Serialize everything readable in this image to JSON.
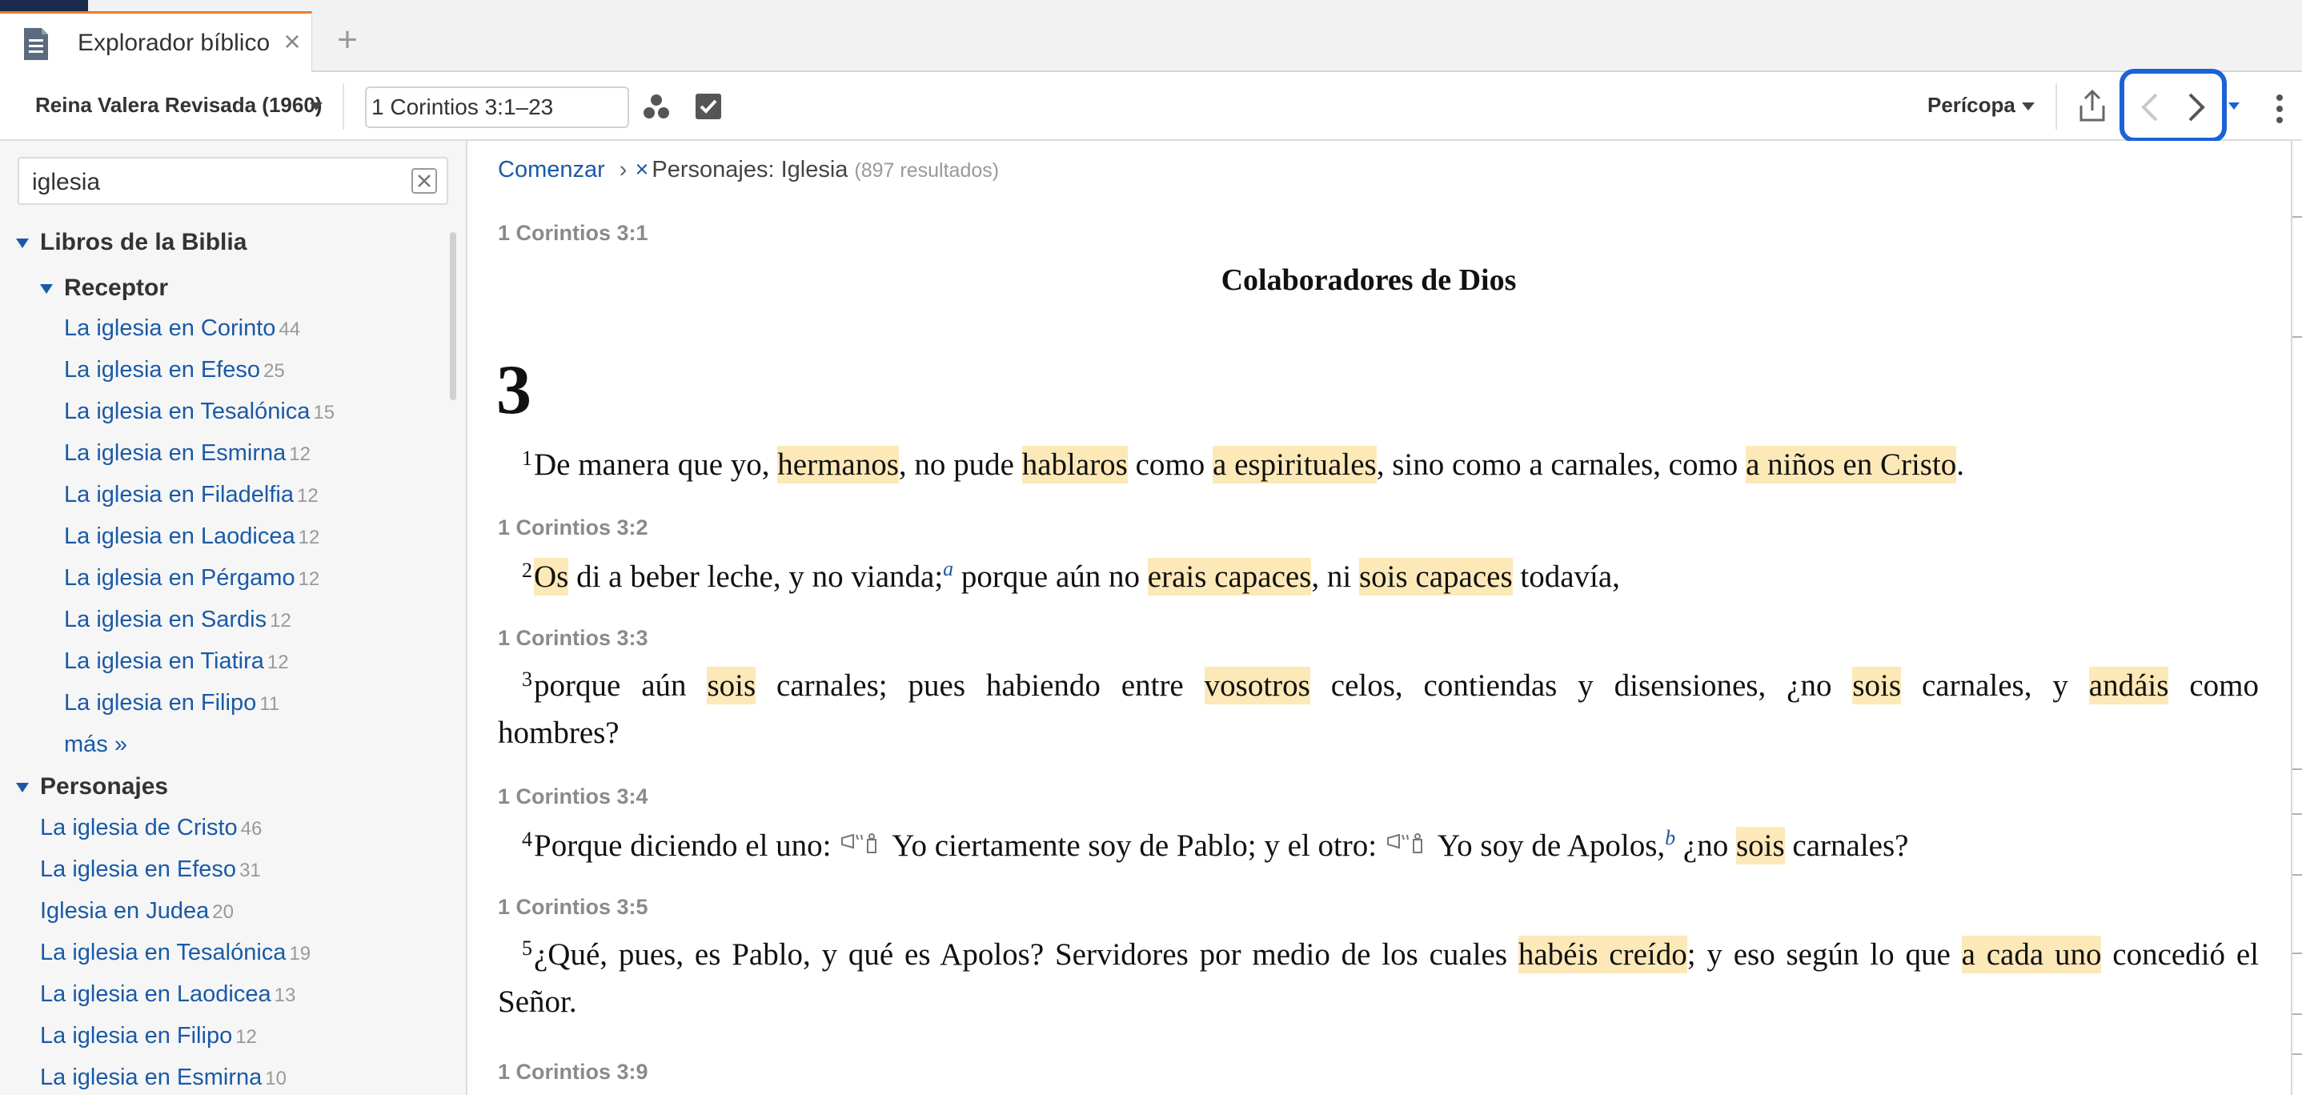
{
  "tab": {
    "title": "Explorador bíblico",
    "close_label": "×",
    "add_label": "+"
  },
  "toolbar": {
    "version": "Reina Valera Revisada (1960)",
    "reference": "1 Corintios 3:1–23",
    "view_mode": "Perícopa"
  },
  "sidebar": {
    "search_value": "iglesia",
    "sections": {
      "libros": {
        "header": "Libros de la Biblia",
        "receptor": {
          "header": "Receptor",
          "items": [
            {
              "label": "La iglesia en Corinto",
              "count": "44"
            },
            {
              "label": "La iglesia en Efeso",
              "count": "25"
            },
            {
              "label": "La iglesia en Tesalónica",
              "count": "15"
            },
            {
              "label": "La iglesia en Esmirna",
              "count": "12"
            },
            {
              "label": "La iglesia en Filadelfia",
              "count": "12"
            },
            {
              "label": "La iglesia en Laodicea",
              "count": "12"
            },
            {
              "label": "La iglesia en Pérgamo",
              "count": "12"
            },
            {
              "label": "La iglesia en Sardis",
              "count": "12"
            },
            {
              "label": "La iglesia en Tiatira",
              "count": "12"
            },
            {
              "label": "La iglesia en Filipo",
              "count": "11"
            }
          ],
          "more_label": "más »"
        }
      },
      "personajes": {
        "header": "Personajes",
        "items": [
          {
            "label": "La iglesia de Cristo",
            "count": "46"
          },
          {
            "label": "La iglesia en Efeso",
            "count": "31"
          },
          {
            "label": "Iglesia en Judea",
            "count": "20"
          },
          {
            "label": "La iglesia en Tesalónica",
            "count": "19"
          },
          {
            "label": "La iglesia en Laodicea",
            "count": "13"
          },
          {
            "label": "La iglesia en Filipo",
            "count": "12"
          },
          {
            "label": "La iglesia en Esmirna",
            "count": "10"
          }
        ]
      }
    }
  },
  "main": {
    "breadcrumb": {
      "start": "Comenzar",
      "separator": "›",
      "remove": "×",
      "current": "Personajes: Iglesia",
      "count": "(897 resultados)"
    },
    "pericope_title": "Colaboradores de Dios",
    "chapter": "3",
    "refs": [
      "1 Corintios 3:1",
      "1 Corintios 3:2",
      "1 Corintios 3:3",
      "1 Corintios 3:4",
      "1 Corintios 3:5",
      "1 Corintios 3:9"
    ],
    "verses": {
      "v1": {
        "num": "1",
        "parts": [
          "De manera que yo, ",
          "hermanos",
          ", no pude ",
          "hablaros",
          " como ",
          "a espirituales",
          ", sino como a carnales, como ",
          "a niños en Cristo",
          "."
        ]
      },
      "v2": {
        "num": "2",
        "parts": [
          "Os",
          " di a beber leche, y no vianda;",
          "a",
          " porque aún no ",
          "erais capaces",
          ", ni ",
          "sois capaces",
          " todavía,"
        ]
      },
      "v3": {
        "num": "3",
        "parts": [
          "porque aún ",
          "sois",
          " carnales; pues habiendo entre ",
          "vosotros",
          " celos, contiendas y disensiones, ¿no ",
          "sois",
          " carnales, y ",
          "andáis",
          " como"
        ],
        "line2": "hombres?"
      },
      "v4": {
        "num": "4",
        "parts": [
          "Porque diciendo el uno: ",
          "Yo ciertamente soy de Pablo; y el otro: ",
          "Yo soy de Apolos,",
          "b",
          " ¿no ",
          "sois",
          " carnales?"
        ]
      },
      "v5": {
        "num": "5",
        "parts": [
          "¿Qué, pues, es Pablo, y qué es Apolos? Servidores por medio de los cuales ",
          "habéis creído",
          "; y eso según lo que ",
          "a cada uno",
          " concedió el"
        ],
        "line2": "Señor."
      }
    }
  },
  "colors": {
    "tab_accent": "#e87d2c",
    "link": "#1a5aa6",
    "highlight": "#fde9b8",
    "nav_highlight": "#1a62d6"
  }
}
